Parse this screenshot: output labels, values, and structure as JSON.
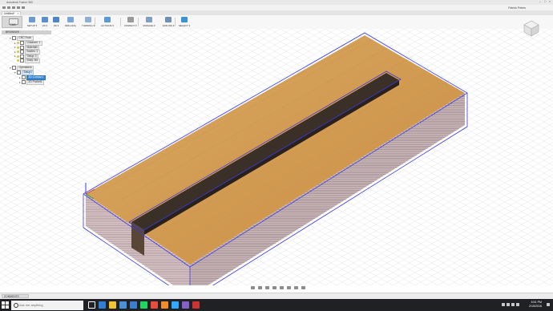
{
  "window": {
    "title": "Autodesk Fusion 360"
  },
  "qat": {
    "undo": "undo-icon",
    "redo": "redo-icon",
    "save": "save-icon",
    "user": "Patrick Peters"
  },
  "document": {
    "tab_label": "Untitled*",
    "close": "×"
  },
  "ribbon": {
    "workspace": "CAM",
    "buttons": [
      {
        "label": "SETUP ▾",
        "icon": "setup-icon",
        "color": "#6b9bd1"
      },
      {
        "label": "2D ▾",
        "icon": "2d-icon",
        "color": "#5a8fc9"
      },
      {
        "label": "3D ▾",
        "icon": "3d-icon",
        "color": "#4c86c4"
      },
      {
        "label": "DRILLING",
        "icon": "drilling-icon",
        "color": "#7aa6d8"
      },
      {
        "label": "TURNING ▾",
        "icon": "turning-icon",
        "color": "#8faed3"
      },
      {
        "label": "ACTIONS ▾",
        "icon": "actions-icon",
        "color": "#5c9ad6"
      },
      {
        "label": "INSPECT ▾",
        "icon": "inspect-icon",
        "color": "#9a9a9a"
      },
      {
        "label": "MANAGE ▾",
        "icon": "manage-icon",
        "color": "#7f9fc5"
      },
      {
        "label": "ADD-INS ▾",
        "icon": "add-ins-icon",
        "color": "#6f8fb4"
      },
      {
        "label": "SELECT ▾",
        "icon": "select-icon",
        "color": "#3a93d6"
      }
    ]
  },
  "browser": {
    "header": "BROWSER",
    "items": [
      {
        "label": "CNC Rock",
        "level": 0,
        "arrow": "▾",
        "kind": "doc"
      },
      {
        "label": "Unsaved: 1",
        "level": 1,
        "arrow": "▸",
        "kind": "folder"
      },
      {
        "label": "Materials",
        "level": 1,
        "arrow": "▸",
        "kind": "folder"
      },
      {
        "label": "Bodies: 1",
        "level": 1,
        "arrow": "▸",
        "kind": "folder"
      },
      {
        "label": "Setup: 1",
        "level": 1,
        "arrow": "▸",
        "kind": "folder"
      },
      {
        "label": "Body: tex",
        "level": 1,
        "arrow": "",
        "kind": "item"
      },
      {
        "label": "Operations",
        "level": 0,
        "arrow": "▾",
        "kind": "doc"
      },
      {
        "label": "Setup1",
        "level": 1,
        "arrow": "▾",
        "kind": "setup"
      },
      {
        "label": "2D Contour1",
        "level": 2,
        "arrow": "▸",
        "kind": "op-selected"
      },
      {
        "label": "2D Pocket1",
        "level": 2,
        "arrow": "▸",
        "kind": "op"
      }
    ]
  },
  "viewcube": {
    "icon": "viewcube-icon"
  },
  "navbar": {
    "icons": [
      "orbit-icon",
      "pan-icon",
      "zoom-icon",
      "fit-icon",
      "look-icon",
      "display-icon",
      "grid-icon",
      "viewports-icon"
    ]
  },
  "comments": {
    "label": "COMMENTS"
  },
  "taskbar": {
    "start": "windows-start-icon",
    "search_placeholder": "Ask me anything",
    "apps": [
      {
        "icon": "task-view-icon",
        "color": "#ffffff"
      },
      {
        "icon": "edge-icon",
        "color": "#2f7fd6"
      },
      {
        "icon": "explorer-icon",
        "color": "#f1c232"
      },
      {
        "icon": "store-icon",
        "color": "#4a90d9"
      },
      {
        "icon": "mail-icon",
        "color": "#3a7fcf"
      },
      {
        "icon": "spotify-icon",
        "color": "#1ed760"
      },
      {
        "icon": "chrome-icon",
        "color": "#e94b3c"
      },
      {
        "icon": "fusion-icon",
        "color": "#f28c28"
      },
      {
        "icon": "photoshop-icon",
        "color": "#31a8ff"
      },
      {
        "icon": "visual-studio-icon",
        "color": "#8661c5"
      },
      {
        "icon": "app-icon",
        "color": "#cc3333"
      }
    ],
    "time": "8:51 PM",
    "date": "2/15/2016"
  },
  "colors": {
    "wood": "#d6a25c",
    "wood_dark": "#b8803c",
    "slot": "#3b3027",
    "toolpath": "#3a3ae0",
    "grid": "#d9dbe2",
    "side_lines": "#9a7a8a"
  }
}
